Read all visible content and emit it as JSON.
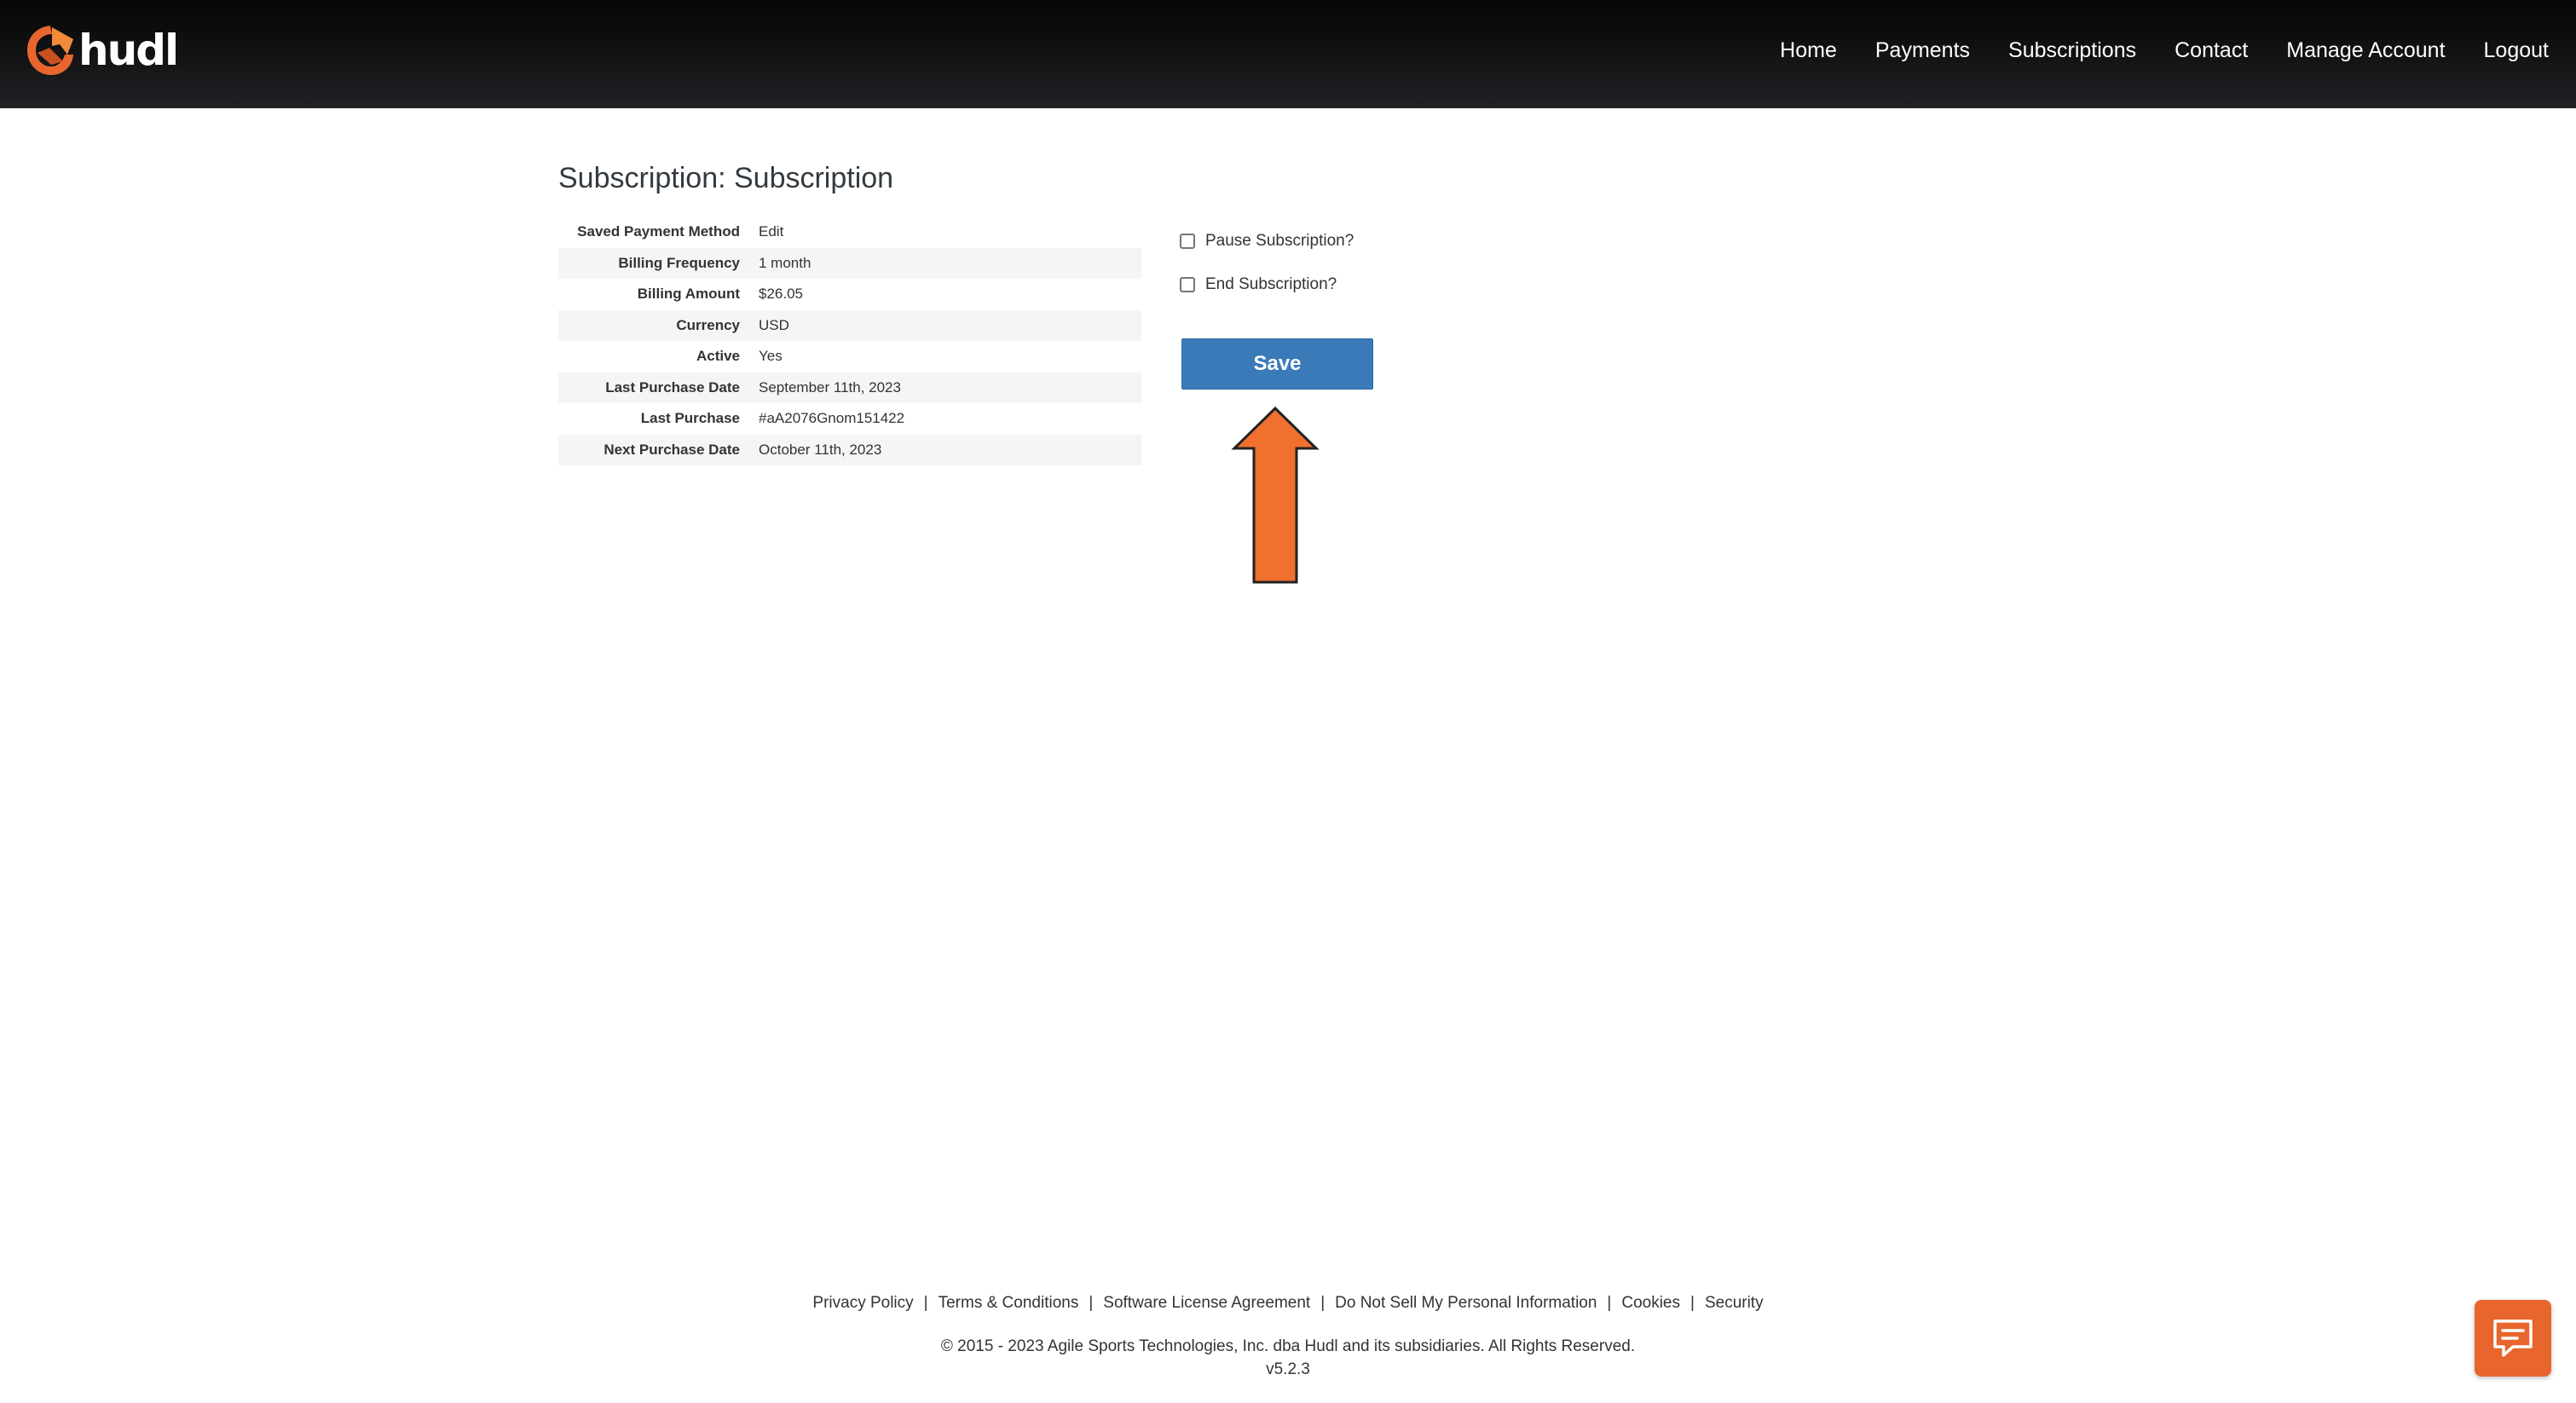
{
  "header": {
    "logo_text": "hudl",
    "nav": [
      {
        "label": "Home"
      },
      {
        "label": "Payments"
      },
      {
        "label": "Subscriptions"
      },
      {
        "label": "Contact"
      },
      {
        "label": "Manage Account"
      },
      {
        "label": "Logout"
      }
    ]
  },
  "main": {
    "title": "Subscription: Subscription",
    "details": [
      {
        "label": "Saved Payment Method",
        "value": "Edit"
      },
      {
        "label": "Billing Frequency",
        "value": "1 month"
      },
      {
        "label": "Billing Amount",
        "value": "$26.05"
      },
      {
        "label": "Currency",
        "value": "USD"
      },
      {
        "label": "Active",
        "value": "Yes"
      },
      {
        "label": "Last Purchase Date",
        "value": "September 11th, 2023"
      },
      {
        "label": "Last Purchase",
        "value": "#aA2076Gnom151422"
      },
      {
        "label": "Next Purchase Date",
        "value": "October 11th, 2023"
      }
    ],
    "options": {
      "pause_label": "Pause Subscription?",
      "end_label": "End Subscription?"
    },
    "save_label": "Save"
  },
  "footer": {
    "links": [
      {
        "label": "Privacy Policy"
      },
      {
        "label": "Terms & Conditions"
      },
      {
        "label": "Software License Agreement"
      },
      {
        "label": "Do Not Sell My Personal Information"
      },
      {
        "label": "Cookies"
      },
      {
        "label": "Security"
      }
    ],
    "separator": "|",
    "copyright": "© 2015 - 2023 Agile Sports Technologies, Inc. dba Hudl and its subsidiaries. All Rights Reserved.",
    "version": "v5.2.3"
  },
  "colors": {
    "header_bg": "#111214",
    "primary_button": "#3a7ab8",
    "accent_orange": "#e8662d",
    "annotation_arrow": "#f07030"
  },
  "icons": {
    "logo": "hudl-logo-icon",
    "annotation": "arrow-up-icon",
    "chat": "chat-bubble-icon"
  }
}
